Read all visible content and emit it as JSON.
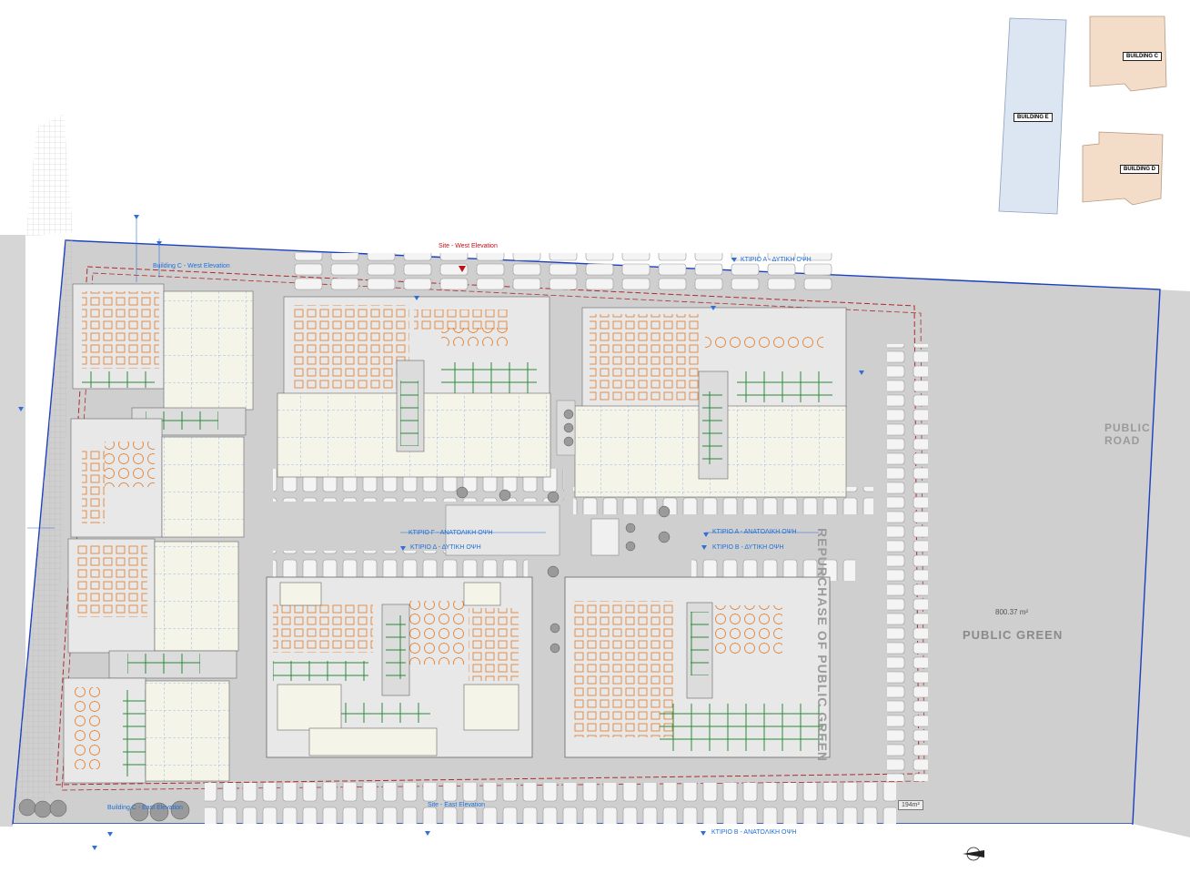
{
  "labels": {
    "site_elevation": "Site - West Elevation",
    "building_c_west": "Building C - West Elevation",
    "ktirio_a_west_top": "ΚΤΙΡΙΟ Α - ΔΥΤΙΚΗ ΟΨΗ",
    "ktirio_g_east": "ΚΤΙΡΙΟ Γ - ΑΝΑΤΟΛΙΚΗ ΟΨΗ",
    "ktirio_d_west": "ΚΤΙΡΙΟ Δ - ΔΥΤΙΚΗ ΟΨΗ",
    "ktirio_a_east": "ΚΤΙΡΙΟ Α - ΑΝΑΤΟΛΙΚΗ ΟΨΗ",
    "ktirio_b_west": "ΚΤΙΡΙΟ Β - ΔΥΤΙΚΗ ΟΨΗ",
    "building_c_east": "Building C - East Elevation",
    "site_east": "Site - East Elevation",
    "ktirio_b_east_bottom": "ΚΤΙΡΙΟ Β - ΑΝΑΤΟΛΙΚΗ ΟΨΗ",
    "public_road": "PUBLIC ROAD",
    "public_green": "PUBLIC GREEN",
    "repurchase": "REPURCHASE OF PUBLIC GREEN",
    "area_green": "800.37 m²",
    "area_small": "194m²"
  },
  "buildings": {
    "e": "BUILDING E",
    "c": "BUILDING C",
    "d": "BUILDING D"
  },
  "colors": {
    "boundary": "#1a3fbf",
    "setback": "#b02a2a",
    "plot": "#cfcfcf",
    "hall": "#e8e8e8",
    "grid_line": "#2f6fd6",
    "tables": "#e07a2a",
    "counter": "#2a8a3a",
    "building_e": "#dce6f2",
    "building_cd": "#f3dcc8",
    "green_area": "#ececec"
  }
}
